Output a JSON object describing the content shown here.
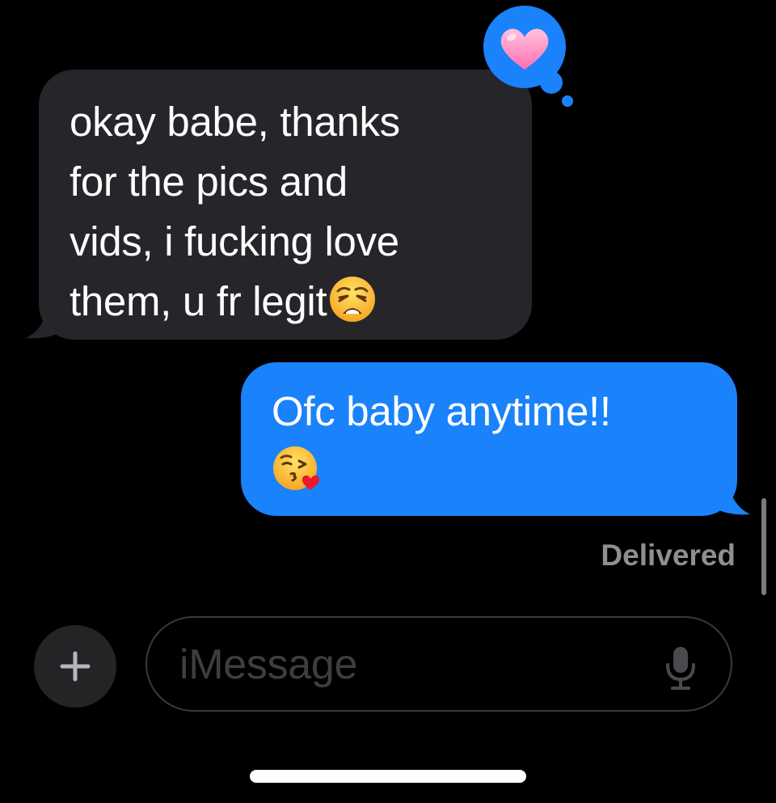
{
  "conversation": {
    "received_message": {
      "text": "okay babe, thanks\nfor the pics and\nvids, i fucking love\nthem, u fr legit",
      "emoji": "weary-face",
      "tapback": "pink-heart"
    },
    "sent_message": {
      "text": "Ofc baby anytime!!",
      "emoji": "face-blowing-a-kiss"
    },
    "status": "Delivered"
  },
  "composer": {
    "placeholder": "iMessage",
    "plus_icon": "plus-icon",
    "mic_icon": "microphone-icon"
  },
  "colors": {
    "background": "#000000",
    "received_bubble": "#26252a",
    "sent_bubble": "#1a82fb",
    "status_text": "#8e8e93",
    "placeholder_text": "#3e3e42"
  }
}
